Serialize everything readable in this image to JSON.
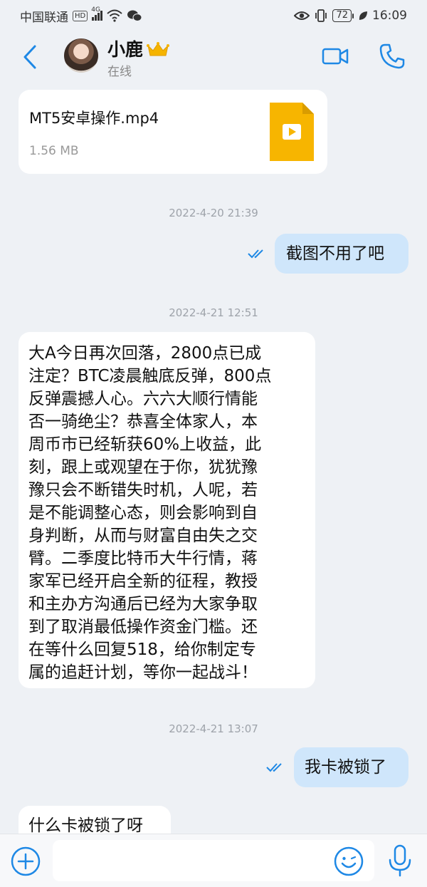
{
  "status_bar": {
    "carrier": "中国联通",
    "hd": "HD",
    "network": "4G",
    "battery": "72",
    "time": "16:09"
  },
  "header": {
    "contact_name": "小鹿",
    "contact_status": "在线"
  },
  "messages": {
    "file": {
      "name": "MT5安卓操作.mp4",
      "size": "1.56 MB"
    },
    "ts1": "2022-4-20 21:39",
    "out1": "截图不用了吧",
    "ts2": "2022-4-21 12:51",
    "in_long": [
      "大A今日再次回落，2800点已成",
      "注定？BTC凌晨触底反弹，800点",
      "反弹震撼人心。六六大顺行情能",
      "否一骑绝尘？恭喜全体家人，本",
      "周币市已经斩获60%上收益，此",
      "刻，跟上或观望在于你，犹犹豫",
      "豫只会不断错失时机，人呢，若",
      "是不能调整心态，则会影响到自",
      "身判断，从而与财富自由失之交",
      "臂。二季度比特币大牛行情，蒋",
      "家军已经开启全新的征程，教授",
      "和主办方沟通后已经为大家争取",
      "到了取消最低操作资金门槛。还",
      "在等什么回复518，给你制定专",
      "属的追赶计划，等你一起战斗！"
    ],
    "ts3": "2022-4-21 13:07",
    "out2": "我卡被锁了",
    "in_partial": "什么卡被锁了呀"
  },
  "input": {
    "placeholder": ""
  },
  "colors": {
    "accent": "#1e88e5",
    "bubble_out": "#cfe6fb",
    "bubble_in": "#ffffff",
    "background": "#eef1f5",
    "file_icon": "#f7b500"
  }
}
